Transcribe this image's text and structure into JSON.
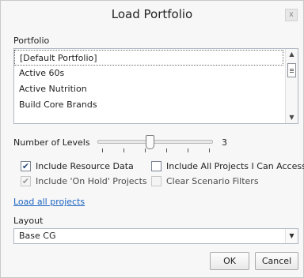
{
  "window": {
    "title": "Load Portfolio",
    "close_glyph": "x"
  },
  "portfolio": {
    "label": "Portfolio",
    "items": [
      {
        "label": "[Default Portfolio]",
        "selected": true
      },
      {
        "label": "Active 60s",
        "selected": false
      },
      {
        "label": "Active Nutrition",
        "selected": false
      },
      {
        "label": "Build Core Brands",
        "selected": false
      }
    ],
    "scroll_up_glyph": "▲",
    "scroll_down_glyph": "▼"
  },
  "levels": {
    "label": "Number of Levels",
    "value": "3",
    "min": 1,
    "max": 6,
    "current": 3
  },
  "options": {
    "include_resource_data": {
      "label": "Include Resource Data",
      "checked": true,
      "enabled": true
    },
    "include_on_hold": {
      "label": "Include 'On Hold' Projects",
      "checked": true,
      "enabled": false
    },
    "include_all_projects": {
      "label": "Include All Projects I Can Access",
      "checked": false,
      "enabled": true
    },
    "clear_scenario_filters": {
      "label": "Clear Scenario Filters",
      "checked": false,
      "enabled": false
    }
  },
  "check_glyph": "✔",
  "load_all_link": "Load all projects",
  "layout": {
    "label": "Layout",
    "value": "Base CG",
    "arrow_glyph": "▼"
  },
  "buttons": {
    "ok": "OK",
    "cancel": "Cancel"
  },
  "colors": {
    "link": "#1b64c0",
    "checkmark": "#2a4d7a",
    "border": "#aeb7c2"
  },
  "icons": {
    "close": "close-icon",
    "checkbox": "checkmark-icon",
    "scroll": "chevron-icon",
    "dropdown": "chevron-down-icon"
  }
}
